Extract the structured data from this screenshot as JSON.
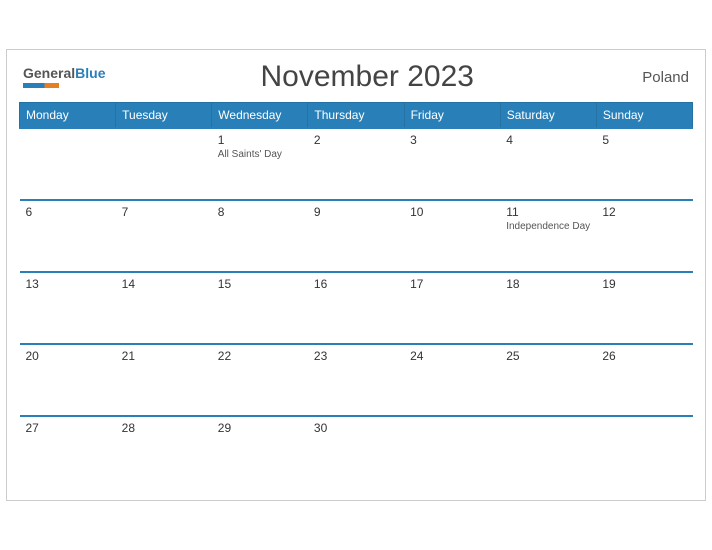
{
  "header": {
    "logo_general": "General",
    "logo_blue": "Blue",
    "title": "November 2023",
    "country": "Poland"
  },
  "weekdays": [
    "Monday",
    "Tuesday",
    "Wednesday",
    "Thursday",
    "Friday",
    "Saturday",
    "Sunday"
  ],
  "weeks": [
    [
      {
        "num": "",
        "holiday": ""
      },
      {
        "num": "",
        "holiday": ""
      },
      {
        "num": "1",
        "holiday": "All Saints' Day"
      },
      {
        "num": "2",
        "holiday": ""
      },
      {
        "num": "3",
        "holiday": ""
      },
      {
        "num": "4",
        "holiday": ""
      },
      {
        "num": "5",
        "holiday": ""
      }
    ],
    [
      {
        "num": "6",
        "holiday": ""
      },
      {
        "num": "7",
        "holiday": ""
      },
      {
        "num": "8",
        "holiday": ""
      },
      {
        "num": "9",
        "holiday": ""
      },
      {
        "num": "10",
        "holiday": ""
      },
      {
        "num": "11",
        "holiday": "Independence Day"
      },
      {
        "num": "12",
        "holiday": ""
      }
    ],
    [
      {
        "num": "13",
        "holiday": ""
      },
      {
        "num": "14",
        "holiday": ""
      },
      {
        "num": "15",
        "holiday": ""
      },
      {
        "num": "16",
        "holiday": ""
      },
      {
        "num": "17",
        "holiday": ""
      },
      {
        "num": "18",
        "holiday": ""
      },
      {
        "num": "19",
        "holiday": ""
      }
    ],
    [
      {
        "num": "20",
        "holiday": ""
      },
      {
        "num": "21",
        "holiday": ""
      },
      {
        "num": "22",
        "holiday": ""
      },
      {
        "num": "23",
        "holiday": ""
      },
      {
        "num": "24",
        "holiday": ""
      },
      {
        "num": "25",
        "holiday": ""
      },
      {
        "num": "26",
        "holiday": ""
      }
    ],
    [
      {
        "num": "27",
        "holiday": ""
      },
      {
        "num": "28",
        "holiday": ""
      },
      {
        "num": "29",
        "holiday": ""
      },
      {
        "num": "30",
        "holiday": ""
      },
      {
        "num": "",
        "holiday": ""
      },
      {
        "num": "",
        "holiday": ""
      },
      {
        "num": "",
        "holiday": ""
      }
    ]
  ]
}
